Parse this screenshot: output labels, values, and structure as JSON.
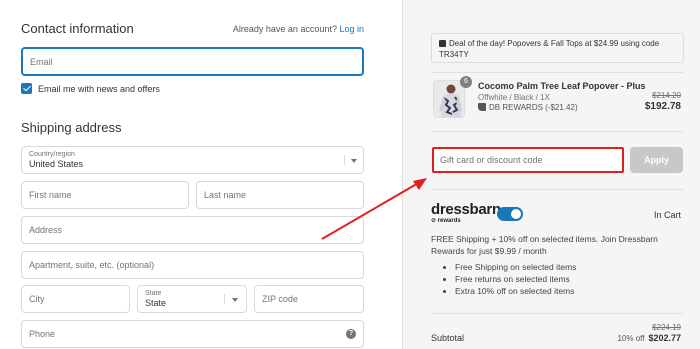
{
  "contact": {
    "title": "Contact information",
    "have_account": "Already have an account?",
    "login_link": "Log in",
    "email_placeholder": "Email",
    "newsletter_label": "Email me with news and offers"
  },
  "shipping": {
    "title": "Shipping address",
    "country_label": "Country/region",
    "country_value": "United States",
    "first_name_placeholder": "First name",
    "last_name_placeholder": "Last name",
    "address_placeholder": "Address",
    "apartment_placeholder": "Apartment, suite, etc. (optional)",
    "city_placeholder": "City",
    "state_label": "State",
    "state_value": "State",
    "zip_placeholder": "ZIP code",
    "phone_placeholder": "Phone",
    "help_glyph": "?"
  },
  "summary": {
    "deal_text": "Deal of the day! Popovers & Fall Tops at $24.99 using code TR34TY",
    "product": {
      "quantity": "6",
      "name": "Cocomo Palm Tree Leaf Popover - Plus",
      "variant": "Offwhite / Black / 1X",
      "reward": "DB REWARDS (-$21.42)",
      "price_original": "$214.20",
      "price_final": "$192.78"
    },
    "discount_placeholder": "Gift card or discount code",
    "apply_label": "Apply",
    "rewards": {
      "brand": "dressbarn",
      "brand_sub": "rewards",
      "toggle_on": true,
      "status": "In Cart",
      "promo_text": "FREE Shipping + 10% off on selected items. Join Dressbarn Rewards for just $9.99 / month",
      "benefits": [
        "Free Shipping on selected items",
        "Free returns on selected items",
        "Extra 10% off on selected items"
      ]
    },
    "subtotal": {
      "label": "Subtotal",
      "original": "$224.19",
      "discount_note": "10% off",
      "final": "$202.77"
    }
  },
  "colors": {
    "accent": "#1878b9",
    "highlight": "#e02020",
    "panel_bg": "#f5f5f5"
  },
  "icons": [
    "gift-icon",
    "tag-icon",
    "chevron-down-icon",
    "help-icon",
    "check-icon"
  ]
}
